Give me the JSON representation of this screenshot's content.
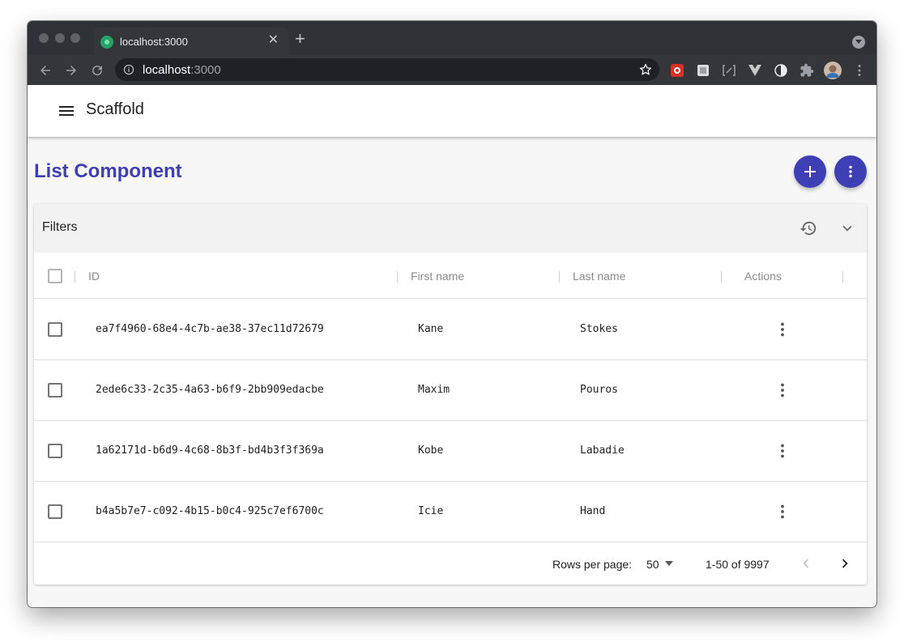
{
  "browser": {
    "tab_title": "localhost:3000",
    "url_host": "localhost",
    "url_port": ":3000",
    "icons": [
      "back-icon",
      "forward-icon",
      "reload-icon",
      "info-icon",
      "star-icon",
      "extension-icon",
      "avatar",
      "more-vert-icon"
    ]
  },
  "app": {
    "title": "Scaffold"
  },
  "page": {
    "title": "List Component",
    "accent": "#3f3fb5"
  },
  "filters": {
    "title": "Filters"
  },
  "table": {
    "columns": [
      "ID",
      "First name",
      "Last name",
      "Actions"
    ],
    "rows": [
      {
        "id": "ea7f4960-68e4-4c7b-ae38-37ec11d72679",
        "first": "Kane",
        "last": "Stokes"
      },
      {
        "id": "2ede6c33-2c35-4a63-b6f9-2bb909edacbe",
        "first": "Maxim",
        "last": "Pouros"
      },
      {
        "id": "1a62171d-b6d9-4c68-8b3f-bd4b3f3f369a",
        "first": "Kobe",
        "last": "Labadie"
      },
      {
        "id": "b4a5b7e7-c092-4b15-b0c4-925c7ef6700c",
        "first": "Icie",
        "last": "Hand"
      }
    ]
  },
  "pagination": {
    "rows_per_page_label": "Rows per page:",
    "rows_per_page_value": "50",
    "range": "1-50 of 9997"
  }
}
